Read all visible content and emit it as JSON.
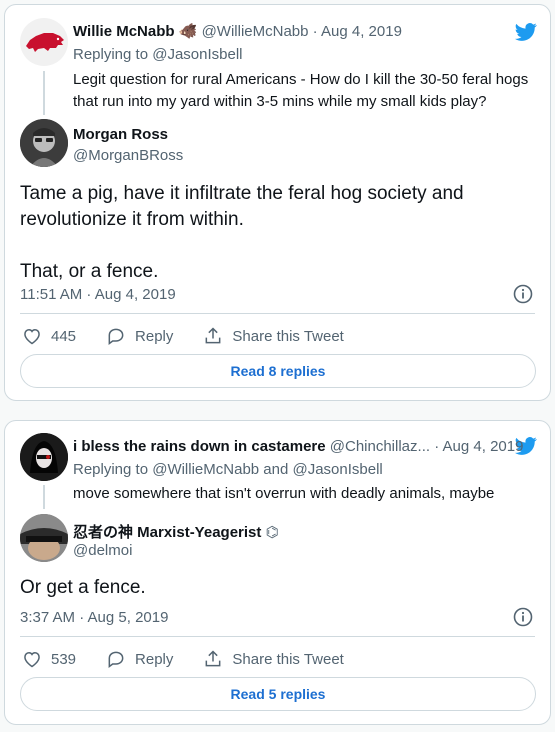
{
  "tweets": [
    {
      "parent": {
        "name": "Willie McNabb",
        "emoji": "🐗",
        "handle": "@WillieMcNabb",
        "date": "· Aug 4, 2019",
        "replying_label": "Replying to",
        "replying_to": "@JasonIsbell",
        "text_line1": "Legit question for rural Americans - How do I kill the 30-50 feral hogs",
        "text_line2": "that run into my yard within 3-5 mins while my small kids play?"
      },
      "reply": {
        "name": "Morgan Ross",
        "handle": "@MorganBRoss",
        "text_line1": "Tame a pig, have it infiltrate the feral hog society and",
        "text_line2": "revolutionize it from within.",
        "text_line3": "That, or a fence.",
        "timestamp": "11:51 AM · Aug 4, 2019",
        "likes": "445",
        "reply_label": "Reply",
        "share_label": "Share this Tweet",
        "read_replies": "Read 8 replies"
      }
    },
    {
      "parent": {
        "name": "i bless the rains down in castamere",
        "handle": "@Chinchillaz...",
        "date": "· Aug 4, 2019",
        "replying_label": "Replying to",
        "replying_to": "@WillieMcNabb and @JasonIsbell",
        "text_line1": "move somewhere that isn't overrun with deadly animals, maybe"
      },
      "reply": {
        "name": "忍者の神 Marxist-Yeagerist",
        "badge": "⌬",
        "handle": "@delmoi",
        "text_line1": "Or get a fence.",
        "timestamp": "3:37 AM · Aug 5, 2019",
        "likes": "539",
        "reply_label": "Reply",
        "share_label": "Share this Tweet",
        "read_replies": "Read 5 replies"
      }
    }
  ],
  "colors": {
    "twitter_blue": "#1d9bf0",
    "link_blue": "#1d6fd1",
    "border": "#cfd9de",
    "muted": "#536471"
  }
}
